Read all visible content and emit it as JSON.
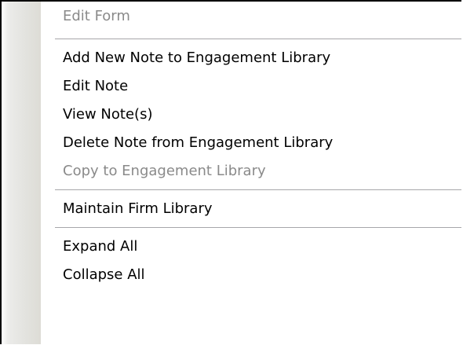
{
  "menu": {
    "items": [
      {
        "label": "Edit Form",
        "enabled": false
      },
      {
        "label": "Add New Note to Engagement Library",
        "enabled": true
      },
      {
        "label": "Edit Note",
        "enabled": true
      },
      {
        "label": "View Note(s)",
        "enabled": true
      },
      {
        "label": "Delete Note from Engagement Library",
        "enabled": true
      },
      {
        "label": "Copy to Engagement Library",
        "enabled": false
      },
      {
        "label": "Maintain Firm Library",
        "enabled": true
      },
      {
        "label": "Expand All",
        "enabled": true
      },
      {
        "label": "Collapse All",
        "enabled": true
      }
    ]
  },
  "colors": {
    "text": "#000000",
    "disabled_text": "#8a8a8a",
    "separator": "#a7a6aa",
    "border": "#000000"
  }
}
